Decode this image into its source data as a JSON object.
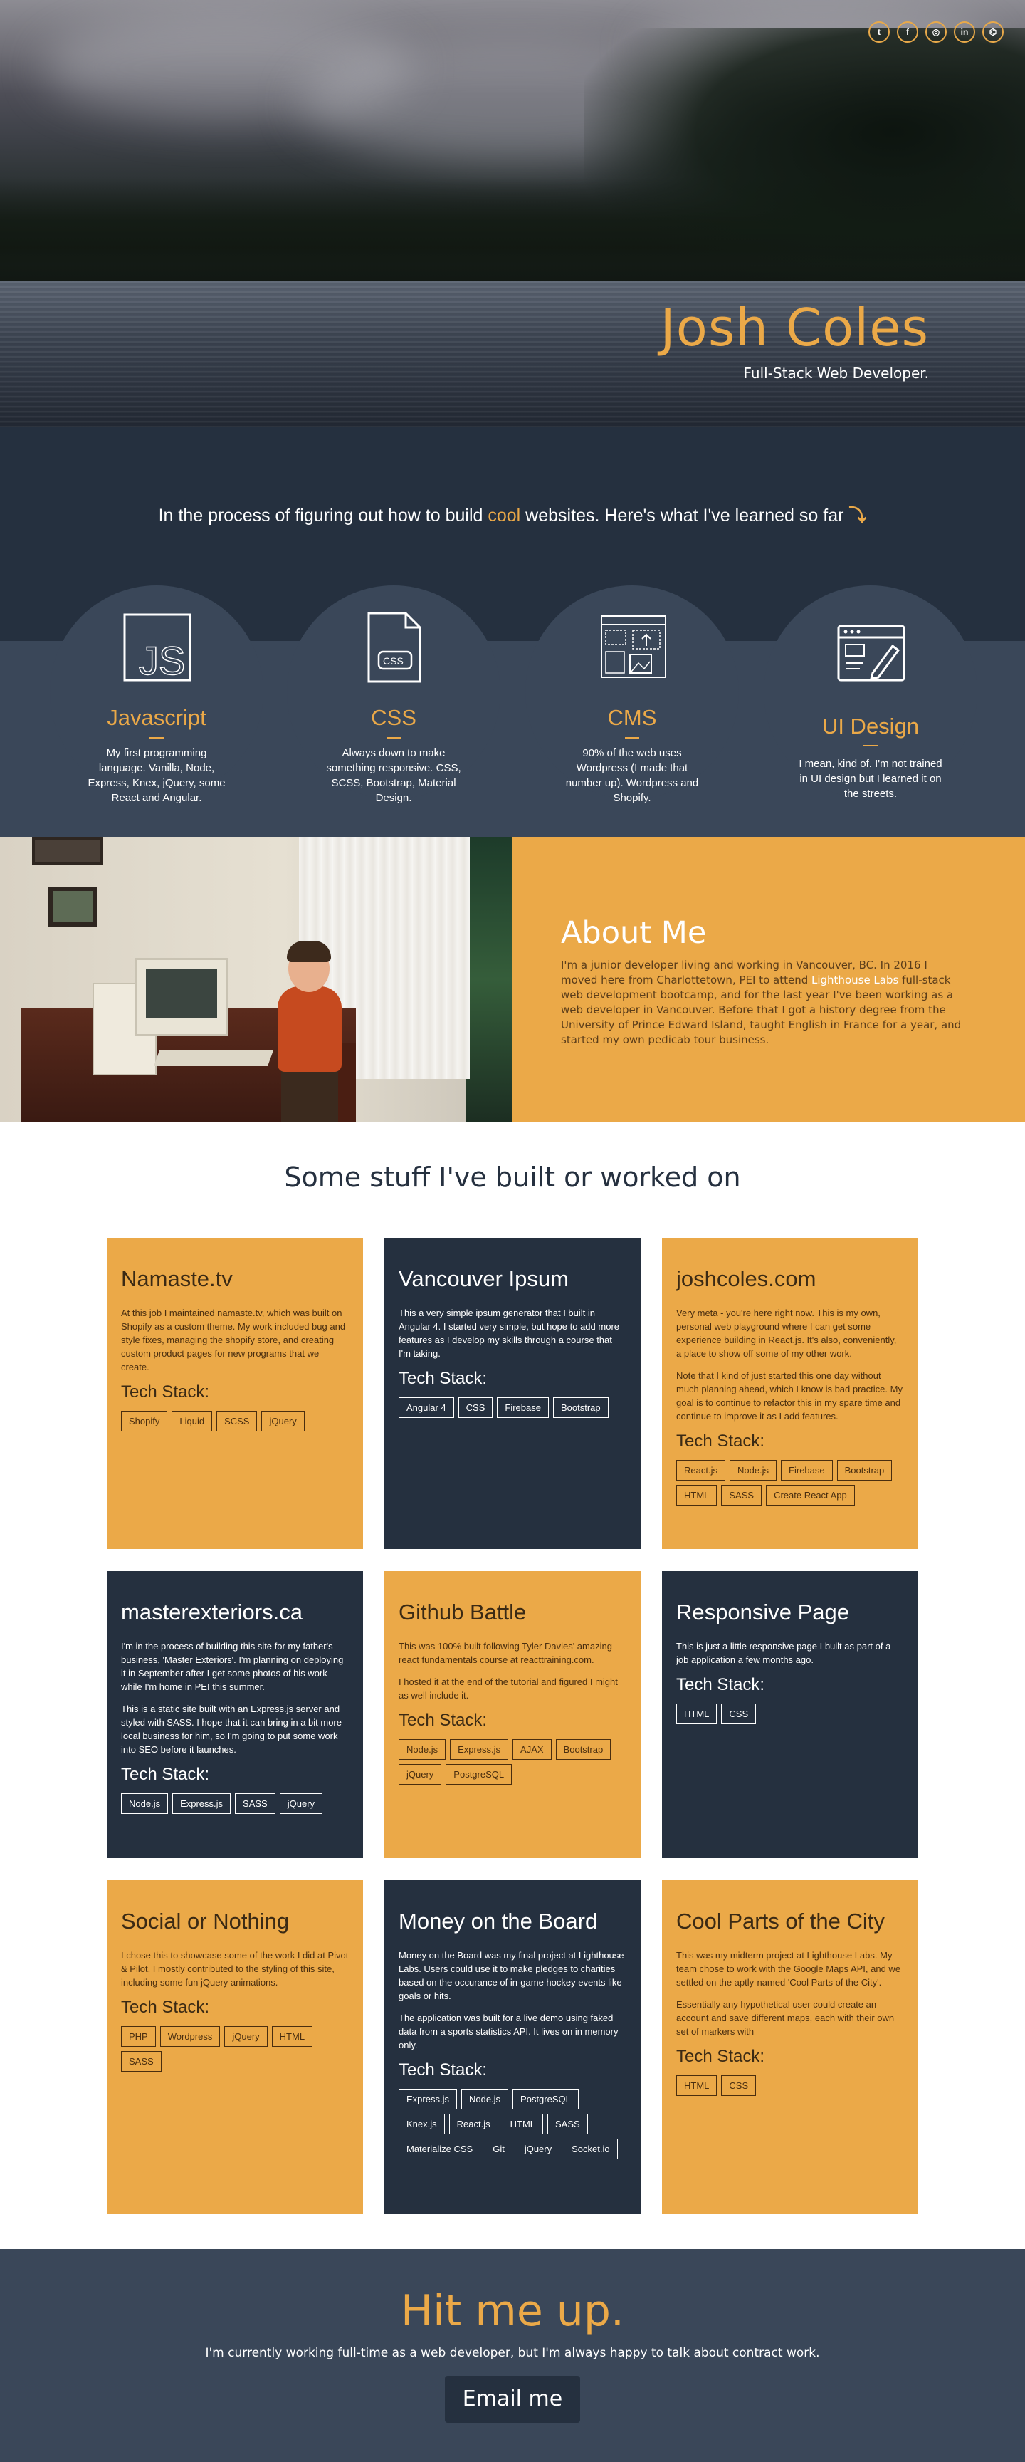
{
  "colors": {
    "accent": "#eba948",
    "navy": "#25303f",
    "slate": "#3a4759"
  },
  "social": [
    {
      "icon": "twitter-icon",
      "glyph": "t"
    },
    {
      "icon": "facebook-icon",
      "glyph": "f"
    },
    {
      "icon": "instagram-icon",
      "glyph": "◎"
    },
    {
      "icon": "linkedin-icon",
      "glyph": "in"
    },
    {
      "icon": "github-icon",
      "glyph": "⌬"
    }
  ],
  "hero": {
    "name": "Josh Coles",
    "subtitle": "Full-Stack Web Developer."
  },
  "skills": {
    "intro_before": "In the process of figuring out how to build ",
    "intro_cool": "cool",
    "intro_after": " websites. Here's what I've learned so far ",
    "intro_arrow": "⤵",
    "items": [
      {
        "icon": "javascript-icon",
        "title": "Javascript",
        "desc": "My first programming language. Vanilla, Node, Express, Knex, jQuery, some React and Angular."
      },
      {
        "icon": "css-file-icon",
        "title": "CSS",
        "desc": "Always down to make something responsive. CSS, SCSS, Bootstrap, Material Design."
      },
      {
        "icon": "cms-layout-icon",
        "title": "CMS",
        "desc": "90% of the web uses Wordpress (I made that number up). Wordpress and Shopify."
      },
      {
        "icon": "ui-design-icon",
        "title": "UI Design",
        "desc": "I mean, kind of. I'm not trained in UI design but I learned it on the streets."
      }
    ]
  },
  "about": {
    "title": "About Me",
    "text_before": "I'm a junior developer living and working in Vancouver, BC. In 2016 I moved here from Charlottetown, PEI to attend ",
    "link": "Lighthouse Labs",
    "text_after": " full-stack web development bootcamp, and for the last year I've been working as a web developer in Vancouver. Before that I got a history degree from the University of Prince Edward Island, taught English in France for a year, and started my own pedicab tour business."
  },
  "projects": {
    "heading": "Some stuff I've built or worked on",
    "tech_label": "Tech Stack:",
    "items": [
      {
        "title": "Namaste.tv",
        "paras": [
          "At this job I maintained namaste.tv, which was built on Shopify as a custom theme. My work included bug and style fixes, managing the shopify store, and creating custom product pages for new programs that we create."
        ],
        "tags": [
          "Shopify",
          "Liquid",
          "SCSS",
          "jQuery"
        ]
      },
      {
        "title": "Vancouver Ipsum",
        "paras": [
          "This a very simple ipsum generator that I built in Angular 4. I started very simple, but hope to add more features as I develop my skills through a course that I'm taking."
        ],
        "tags": [
          "Angular 4",
          "CSS",
          "Firebase",
          "Bootstrap"
        ]
      },
      {
        "title": "joshcoles.com",
        "paras": [
          "Very meta - you're here right now. This is my own, personal web playground where I can get some experience building in React.js. It's also, conveniently, a place to show off some of my other work.",
          "Note that I kind of just started this one day without much planning ahead, which I know is bad practice. My goal is to continue to refactor this in my spare time and continue to improve it as I add features."
        ],
        "tags": [
          "React.js",
          "Node.js",
          "Firebase",
          "Bootstrap",
          "HTML",
          "SASS",
          "Create React App"
        ]
      },
      {
        "title": "masterexteriors.ca",
        "paras": [
          "I'm in the process of building this site for my father's business, 'Master Exteriors'. I'm planning on deploying it in September after I get some photos of his work while I'm home in PEI this summer.",
          "This is a static site built with an Express.js server and styled with SASS. I hope that it can bring in a bit more local business for him, so I'm going to put some work into SEO before it launches."
        ],
        "tags": [
          "Node.js",
          "Express.js",
          "SASS",
          "jQuery"
        ]
      },
      {
        "title": "Github Battle",
        "paras": [
          "This was 100% built following Tyler Davies' amazing react fundamentals course at reacttraining.com.",
          "I hosted it at the end of the tutorial and figured I might as well include it."
        ],
        "tags": [
          "Node.js",
          "Express.js",
          "AJAX",
          "Bootstrap",
          "jQuery",
          "PostgreSQL"
        ]
      },
      {
        "title": "Responsive Page",
        "paras": [
          "This is just a little responsive page I built as part of a job application a few months ago."
        ],
        "tags": [
          "HTML",
          "CSS"
        ]
      },
      {
        "title": "Social or Nothing",
        "paras": [
          "I chose this to showcase some of the work I did at Pivot & Pilot. I mostly contributed to the styling of this site, including some fun jQuery animations."
        ],
        "tags": [
          "PHP",
          "Wordpress",
          "jQuery",
          "HTML",
          "SASS"
        ]
      },
      {
        "title": "Money on the Board",
        "paras": [
          "Money on the Board was my final project at Lighthouse Labs. Users could use it to make pledges to charities based on the occurance of in-game hockey events like goals or hits.",
          "The application was built for a live demo using faked data from a sports statistics API. It lives on in memory only."
        ],
        "tags": [
          "Express.js",
          "Node.js",
          "PostgreSQL",
          "Knex.js",
          "React.js",
          "HTML",
          "SASS",
          "Materialize CSS",
          "Git",
          "jQuery",
          "Socket.io"
        ]
      },
      {
        "title": "Cool Parts of the City",
        "paras": [
          "This was my midterm project at Lighthouse Labs. My team chose to work with the Google Maps API, and we settled on the aptly-named 'Cool Parts of the City'.",
          "Essentially any hypothetical user could create an account and save different maps, each with their own set of markers with"
        ],
        "tags": [
          "HTML",
          "CSS"
        ]
      }
    ]
  },
  "contact": {
    "title": "Hit me up.",
    "text": "I'm currently working full-time as a web developer, but I'm always happy to talk about contract work.",
    "button": "Email me"
  }
}
